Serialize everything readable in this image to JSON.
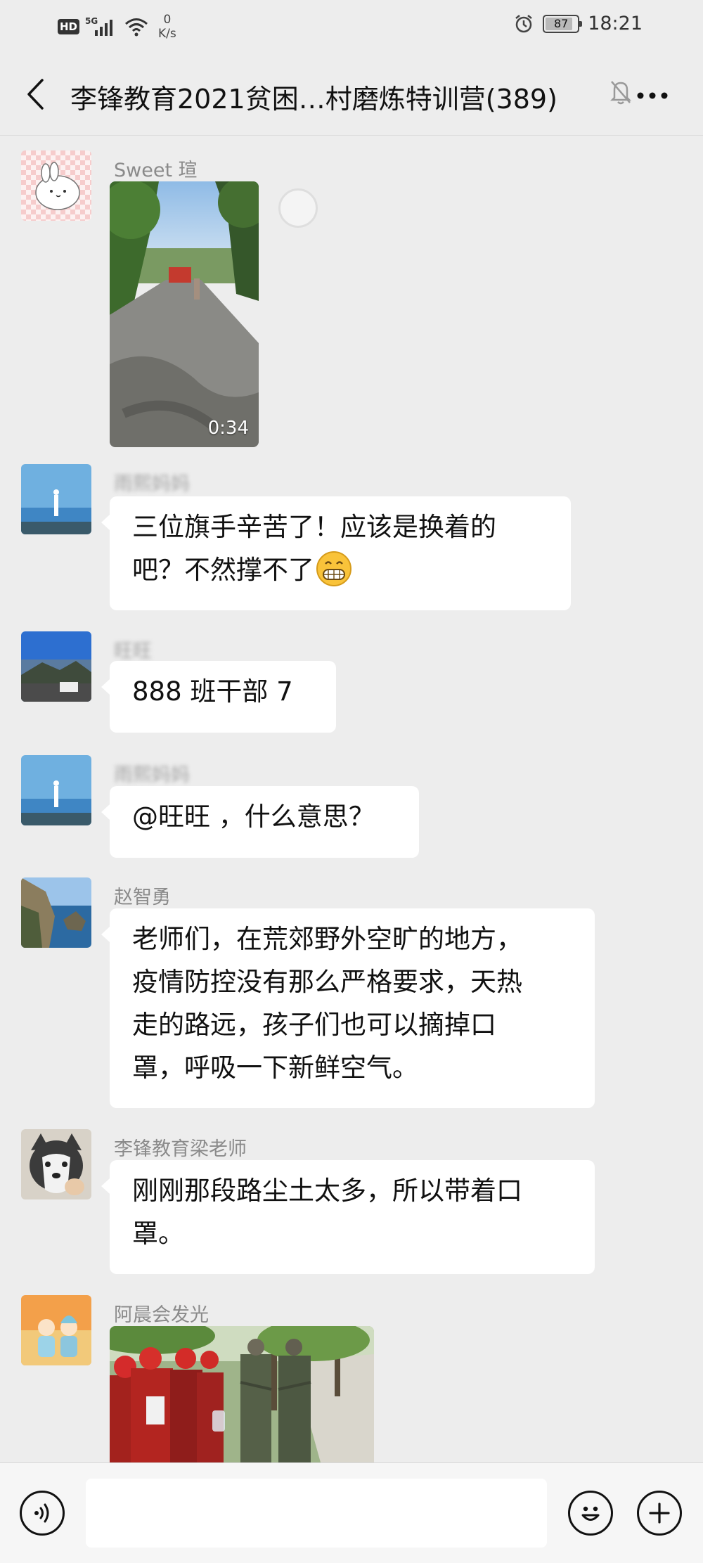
{
  "status_bar": {
    "hd": "HD",
    "network": "5G",
    "net_speed_value": "0",
    "net_speed_unit": "K/s",
    "battery": "87",
    "battery_level": 0.87,
    "time": "18:21",
    "icons": [
      "hd-icon",
      "signal-icon",
      "wifi-icon",
      "alarm-icon",
      "battery-icon"
    ]
  },
  "header": {
    "title": "李锋教育2021贫困…村磨炼特训营(389)",
    "back_icon": "chevron-left-icon",
    "mute_icon": "bell-off-icon",
    "more_icon": "more-dots-icon"
  },
  "messages": [
    {
      "type": "video",
      "sender": "Sweet 瑄",
      "duration": "0:34"
    },
    {
      "type": "text",
      "sender": "雨熙妈妈",
      "lines": [
        "三位旗手辛苦了！应该是换着的",
        "吧？不然撑不了"
      ],
      "emoji": "grin-emoji"
    },
    {
      "type": "text",
      "sender": "旺旺",
      "lines": [
        "888 班干部   7"
      ]
    },
    {
      "type": "text",
      "sender": "雨熙妈妈",
      "lines": [
        "@旺旺 ，什么意思？"
      ]
    },
    {
      "type": "text",
      "sender": "赵智勇",
      "lines": [
        "老师们，在荒郊野外空旷的地方，",
        "疫情防控没有那么严格要求，天热",
        "走的路远，孩子们也可以摘掉口",
        "罩，呼吸一下新鲜空气。"
      ]
    },
    {
      "type": "text",
      "sender": "李锋教育梁老师",
      "lines": [
        "刚刚那段路尘土太多，所以带着口",
        "罩。"
      ]
    },
    {
      "type": "image",
      "sender": "阿晨会发光"
    }
  ],
  "input_bar": {
    "voice_icon": "voice-icon",
    "emoji_icon": "emoji-icon",
    "plus_icon": "plus-icon",
    "placeholder": ""
  }
}
